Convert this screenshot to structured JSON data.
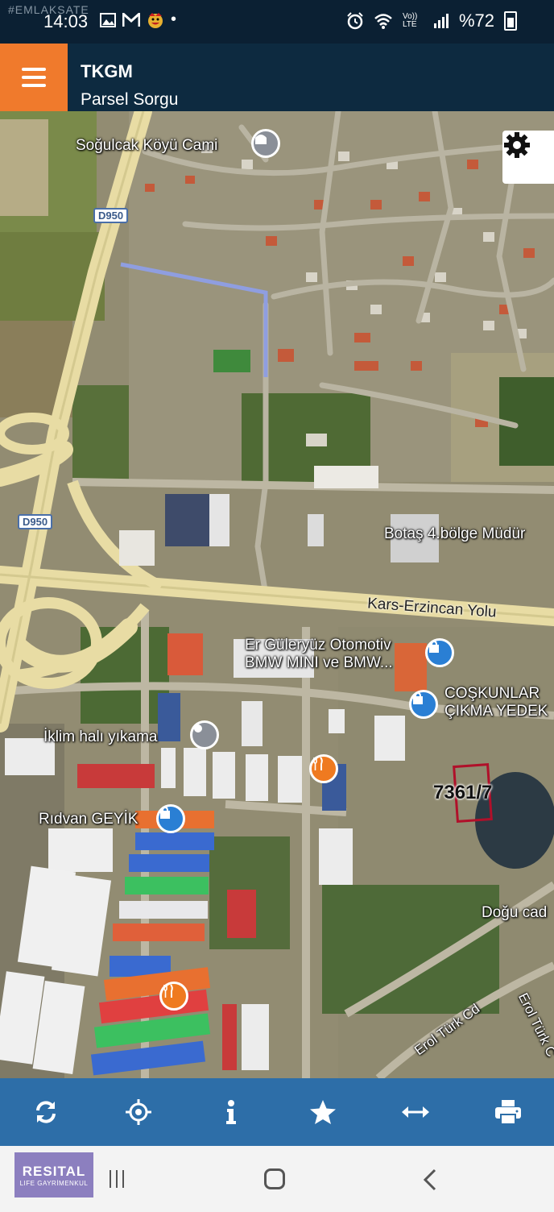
{
  "status_bar": {
    "watermark": "#EMLAKSATE",
    "time": "14:03",
    "notification_icons": [
      "image-icon",
      "gmail-icon",
      "emoji-icon"
    ],
    "dot": "•",
    "network_label": "Vo)) LTE",
    "battery": "%72"
  },
  "app_bar": {
    "title": "TKGM",
    "subtitle": "Parsel Sorgu",
    "accent_color": "#f07a2c",
    "background_color": "#0d2a40"
  },
  "map": {
    "place_labels": {
      "mosque": "Soğulcak Köyü Cami",
      "botas": "Botaş 4.bölge Müdür",
      "automotive": "Er Güleryüz Otomotiv BMW MINI ve BMW...",
      "coskunlar": "COŞKUNLAR ÇIKMA YEDEK",
      "iklim": "İklim halı yıkama",
      "ridvan": "Rıdvan GEYİK",
      "dogu": "Doğu cad",
      "erol1": "Erol Türk Cd",
      "erol2": "Erol Türk C"
    },
    "road_labels": {
      "kars": "Kars-Erzincan Yolu"
    },
    "highway_shields": [
      "D950",
      "D950"
    ],
    "parcel": {
      "label": "7361/7",
      "outline_color": "#b0102a"
    }
  },
  "toolbar": {
    "background_color": "#2d6ea8",
    "tools": [
      "refresh-icon",
      "locate-icon",
      "info-icon",
      "favorite-icon",
      "measure-icon",
      "print-icon"
    ]
  },
  "nav_bar": {
    "brand_name": "RESITAL",
    "brand_tagline": "LIFE GAYRİMENKUL"
  }
}
